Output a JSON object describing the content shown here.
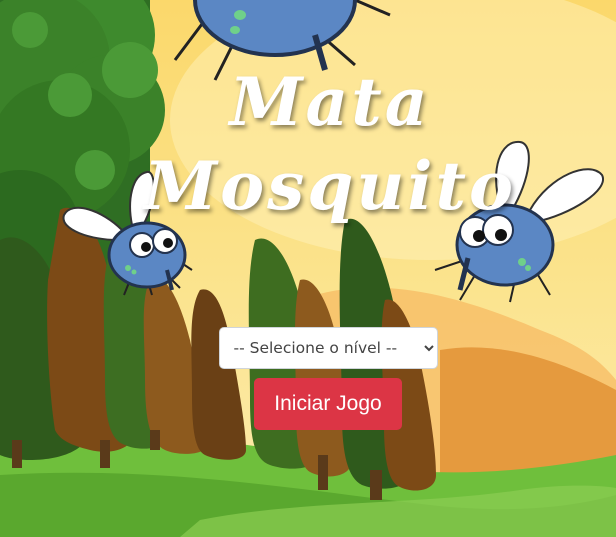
{
  "game": {
    "title_line1": "Mata",
    "title_line2": "Mosquito"
  },
  "level_select": {
    "selected_label": "-- Selecione o nível --",
    "options": [
      "-- Selecione o nível --"
    ]
  },
  "start_button": {
    "label": "Iniciar Jogo"
  },
  "colors": {
    "sky_top": "#fde7a0",
    "sky_bottom": "#fbe08c",
    "grass": "#5fb535",
    "start_button": "#dc3545",
    "mosquito_body": "#5b87c4"
  },
  "icons": [
    "mosquito-icon",
    "tree-icon",
    "bush-icon"
  ]
}
